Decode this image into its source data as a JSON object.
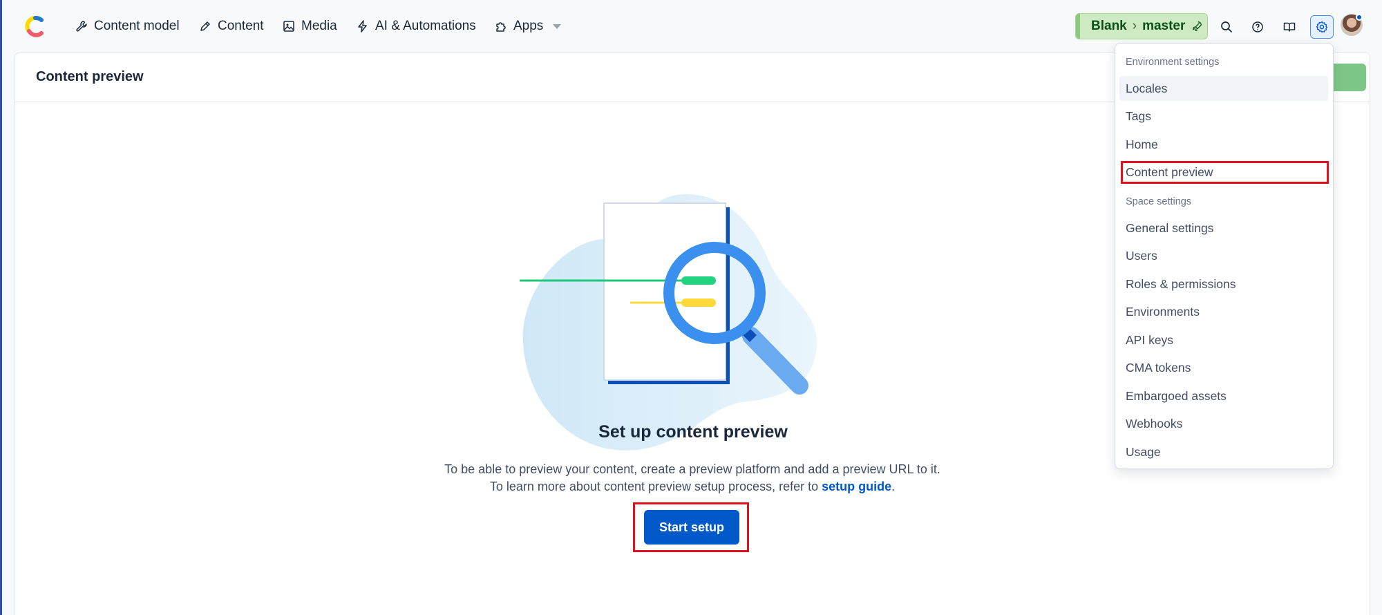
{
  "nav": {
    "items": [
      {
        "label": "Content model",
        "icon": "wrench-icon"
      },
      {
        "label": "Content",
        "icon": "pen-icon"
      },
      {
        "label": "Media",
        "icon": "image-icon"
      },
      {
        "label": "AI & Automations",
        "icon": "lightning-icon"
      },
      {
        "label": "Apps",
        "icon": "puzzle-icon"
      }
    ],
    "environment": {
      "space": "Blank",
      "branch": "master",
      "icon": "rocket-icon"
    },
    "icons": [
      "search-icon",
      "help-icon",
      "book-icon",
      "gear-icon",
      "avatar"
    ]
  },
  "page": {
    "title": "Content preview"
  },
  "empty_state": {
    "title": "Set up content preview",
    "text_before_link": "To be able to preview your content, create a preview platform and add a preview URL to it. To learn more about content preview setup process, refer to ",
    "link": "setup guide",
    "text_after_link": ".",
    "button": "Start setup"
  },
  "menu": {
    "env_section": "Environment settings",
    "env_items": [
      "Locales",
      "Tags",
      "Home",
      "Content preview"
    ],
    "space_section": "Space settings",
    "space_items": [
      "General settings",
      "Users",
      "Roles & permissions",
      "Environments",
      "API keys",
      "CMA tokens",
      "Embargoed assets",
      "Webhooks",
      "Usage"
    ]
  },
  "colors": {
    "primary": "#0059c8",
    "highlight_box": "#e0101c",
    "env_green": "#cdeac3"
  }
}
